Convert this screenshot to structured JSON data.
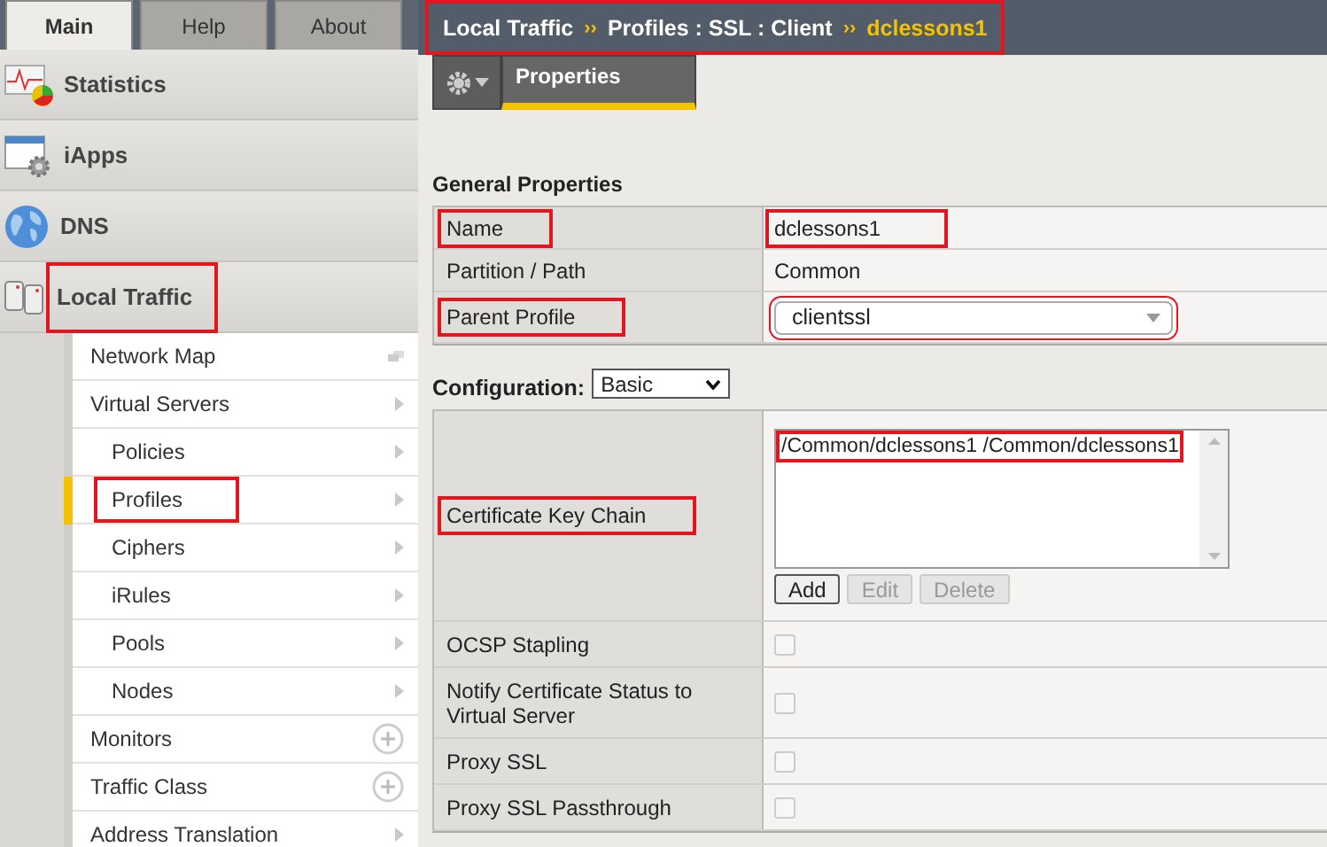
{
  "nav_tabs": [
    {
      "label": "Main",
      "selected": true
    },
    {
      "label": "Help",
      "selected": false
    },
    {
      "label": "About",
      "selected": false
    }
  ],
  "sidebar": {
    "sections": [
      {
        "label": "Statistics",
        "kind": "statistics",
        "highlighted": false
      },
      {
        "label": "iApps",
        "kind": "iapps",
        "highlighted": false
      },
      {
        "label": "DNS",
        "kind": "dns",
        "highlighted": false
      },
      {
        "label": "Local Traffic",
        "kind": "local-traffic",
        "highlighted": true
      }
    ],
    "items": [
      {
        "label": "Network Map",
        "kind": "map",
        "selected": false,
        "highlighted": false
      },
      {
        "label": "Virtual Servers",
        "kind": "arrow",
        "selected": false,
        "highlighted": false,
        "children": [
          {
            "label": "Policies",
            "kind": "arrow",
            "selected": false,
            "highlighted": false
          },
          {
            "label": "Profiles",
            "kind": "arrow",
            "selected": true,
            "highlighted": true
          },
          {
            "label": "Ciphers",
            "kind": "arrow",
            "selected": false,
            "highlighted": false
          },
          {
            "label": "iRules",
            "kind": "arrow",
            "selected": false,
            "highlighted": false
          },
          {
            "label": "Pools",
            "kind": "arrow",
            "selected": false,
            "highlighted": false
          },
          {
            "label": "Nodes",
            "kind": "arrow",
            "selected": false,
            "highlighted": false
          }
        ]
      },
      {
        "label": "Monitors",
        "kind": "plus",
        "selected": false,
        "highlighted": false
      },
      {
        "label": "Traffic Class",
        "kind": "plus",
        "selected": false,
        "highlighted": false
      },
      {
        "label": "Address Translation",
        "kind": "arrow",
        "selected": false,
        "highlighted": false
      }
    ]
  },
  "breadcrumb": {
    "highlighted": true,
    "separator": "››",
    "parts": [
      {
        "label": "Local Traffic",
        "current": false
      },
      {
        "label": "Profiles : SSL : Client",
        "current": false
      },
      {
        "label": "dclessons1",
        "current": true
      }
    ]
  },
  "page_tabs": [
    {
      "label": "Properties",
      "selected": true
    }
  ],
  "general_properties": {
    "title": "General Properties",
    "rows": [
      {
        "label": "Name",
        "kind": "text",
        "value": "dclessons1",
        "highlighted": true
      },
      {
        "label": "Partition / Path",
        "kind": "text",
        "value": "Common",
        "highlighted": false
      },
      {
        "label": "Parent Profile",
        "kind": "select",
        "value": "clientssl",
        "highlighted": true
      }
    ]
  },
  "configuration": {
    "label": "Configuration:",
    "mode": "Basic",
    "rows": [
      {
        "label": "Certificate Key Chain",
        "kind": "keychain",
        "highlighted": true,
        "entries": [
          {
            "text": "/Common/dclessons1 /Common/dclessons1",
            "highlighted": true
          }
        ],
        "buttons": [
          {
            "label": "Add",
            "disabled": false
          },
          {
            "label": "Edit",
            "disabled": true
          },
          {
            "label": "Delete",
            "disabled": true
          }
        ]
      },
      {
        "label": "OCSP Stapling",
        "kind": "checkbox",
        "checked": false,
        "highlighted": false
      },
      {
        "label": "Notify Certificate Status to Virtual Server",
        "kind": "checkbox",
        "checked": false,
        "highlighted": false
      },
      {
        "label": "Proxy SSL",
        "kind": "checkbox",
        "checked": false,
        "highlighted": false
      },
      {
        "label": "Proxy SSL Passthrough",
        "kind": "checkbox",
        "checked": false,
        "highlighted": false
      }
    ]
  }
}
